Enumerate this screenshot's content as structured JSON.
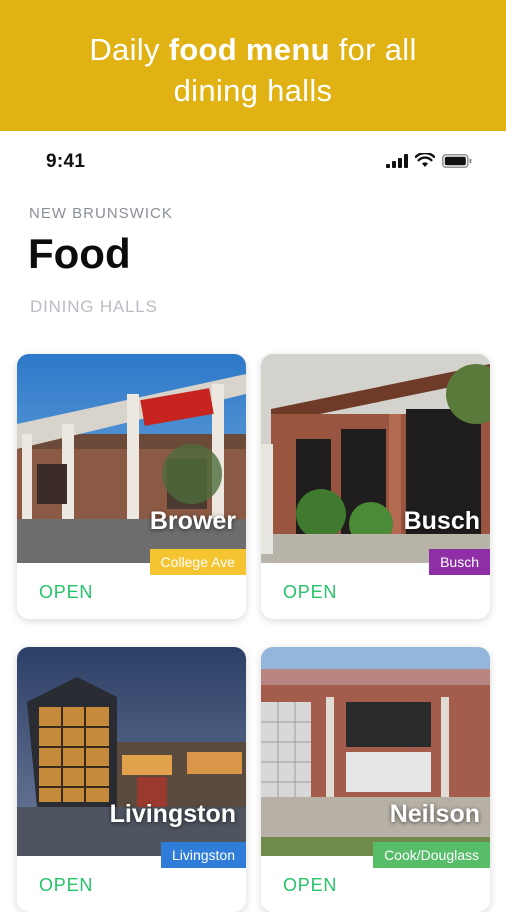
{
  "banner": {
    "line1_pre": "Daily ",
    "line1_bold": "food menu",
    "line1_post": " for all",
    "line2": "dining halls"
  },
  "statusbar": {
    "time": "9:41"
  },
  "header": {
    "region": "NEW BRUNSWICK",
    "title": "Food",
    "section": "DINING HALLS"
  },
  "halls": [
    {
      "name": "Brower",
      "campus": "College Ave",
      "status": "OPEN",
      "tag_color": "#f5c431"
    },
    {
      "name": "Busch",
      "campus": "Busch",
      "status": "OPEN",
      "tag_color": "#8e2fa6"
    },
    {
      "name": "Livingston",
      "campus": "Livingston",
      "status": "OPEN",
      "tag_color": "#2f7dd9"
    },
    {
      "name": "Neilson",
      "campus": "Cook/Douglass",
      "status": "OPEN",
      "tag_color": "#57bd69"
    }
  ],
  "colors": {
    "banner": "#e0b214",
    "open": "#25c46a"
  }
}
